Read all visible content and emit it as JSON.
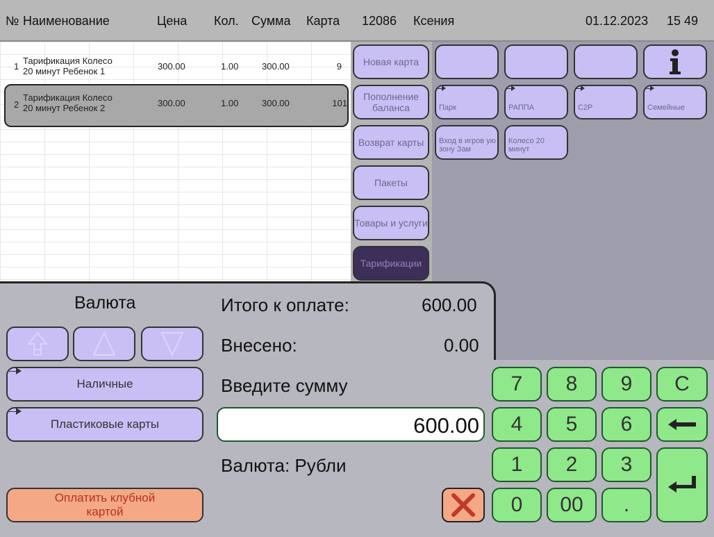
{
  "header": {
    "col_num": "№",
    "col_name": "Наименование",
    "col_price": "Цена",
    "col_qty": "Кол.",
    "col_sum": "Сумма",
    "col_card": "Карта",
    "terminal": "12086",
    "user": "Ксения",
    "date": "01.12.2023",
    "time": "15 49"
  },
  "rows": [
    {
      "num": "1",
      "name1": "Тарификация Колесо",
      "name2": "20 минут Ребенок 1",
      "price": "300.00",
      "qty": "1.00",
      "sum": "300.00",
      "card": "9"
    },
    {
      "num": "2",
      "name1": "Тарификация Колесо",
      "name2": "20 минут Ребенок 2",
      "price": "300.00",
      "qty": "1.00",
      "sum": "300.00",
      "card": "101"
    }
  ],
  "nav": {
    "new_card": "Новая карта",
    "top_up": "Пополнение баланса",
    "return_card": "Возврат карты",
    "packages": "Пакеты",
    "goods": "Товары и услуги",
    "tariffs": "Тарификации"
  },
  "tiles": {
    "park": "Парк",
    "rappa": "РАППА",
    "c2p": "C2P",
    "family": "Семейные",
    "entry": "Вход в игров ую зону Зам",
    "wheel": "Колесо 20 минут"
  },
  "payment": {
    "currency_title": "Валюта",
    "cash": "Наличные",
    "plastic": "Пластиковые карты",
    "club_pay": "Оплатить клубной картой",
    "total_label": "Итого к оплате:",
    "total_value": "600.00",
    "paid_label": "Внесено:",
    "paid_value": "0.00",
    "enter_label": "Введите сумму",
    "amount": "600.00",
    "currency_label": "Валюта: Рубли"
  },
  "keypad": {
    "k7": "7",
    "k8": "8",
    "k9": "9",
    "kc": "C",
    "k4": "4",
    "k5": "5",
    "k6": "6",
    "k1": "1",
    "k2": "2",
    "k3": "3",
    "k0": "0",
    "k00": "00",
    "kdot": "."
  },
  "colors": {
    "accent_purple": "#c9bff5",
    "keypad_green": "#8fe88a",
    "cancel_orange": "#f4a886",
    "cancel_red": "#c0392b"
  }
}
